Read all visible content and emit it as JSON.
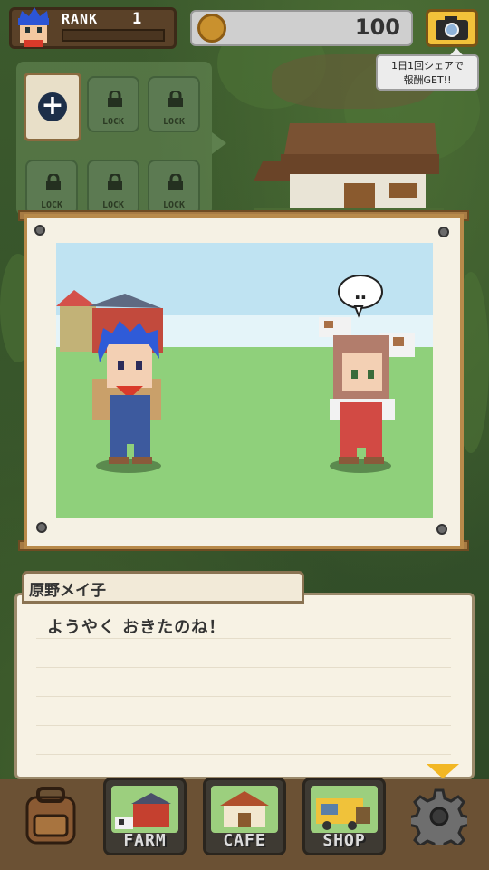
{
  "player": {
    "rank_label": "RANK",
    "rank_value": "1",
    "avatar": "player-avatar-icon"
  },
  "currency": {
    "amount": "100",
    "icon": "coin-icon"
  },
  "share": {
    "icon": "camera-icon",
    "tooltip_line1": "1日1回シェアで",
    "tooltip_line2": "報酬GET!!"
  },
  "slots": {
    "add_icon": "plus-icon",
    "locked_label": "LOCK",
    "locked_count": 5
  },
  "dialogue": {
    "speaker": "原野メイ子",
    "text": "ようやく おきたのね！",
    "speech_bubble": "‥",
    "next_icon": "triangle-down-icon"
  },
  "nav": {
    "bag_icon": "backpack-icon",
    "items": [
      {
        "label": "FARM",
        "icon": "barn-icon"
      },
      {
        "label": "CAFE",
        "icon": "cafe-icon"
      },
      {
        "label": "SHOP",
        "icon": "food-truck-icon"
      }
    ],
    "settings_icon": "gear-icon"
  },
  "colors": {
    "accent": "#f2b724",
    "grass": "#8fd07b",
    "sky": "#bfe3f2",
    "frame": "#b88a4a"
  }
}
